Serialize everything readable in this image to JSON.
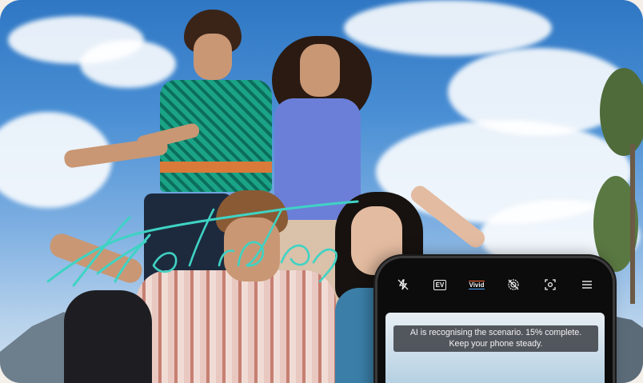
{
  "hero": {
    "script_text": "Holidays",
    "script_color": "#3fd3c4"
  },
  "camera": {
    "toolbar": [
      {
        "name": "flash-off-icon",
        "label": ""
      },
      {
        "name": "ev-icon",
        "label": "EV"
      },
      {
        "name": "vivid-icon",
        "label": "Vivid"
      },
      {
        "name": "live-off-icon",
        "label": ""
      },
      {
        "name": "focus-icon",
        "label": ""
      },
      {
        "name": "menu-icon",
        "label": ""
      }
    ],
    "toast_text": "AI is recognising the scenario. 15% complete. Keep your phone steady.",
    "progress_percent": 15
  }
}
